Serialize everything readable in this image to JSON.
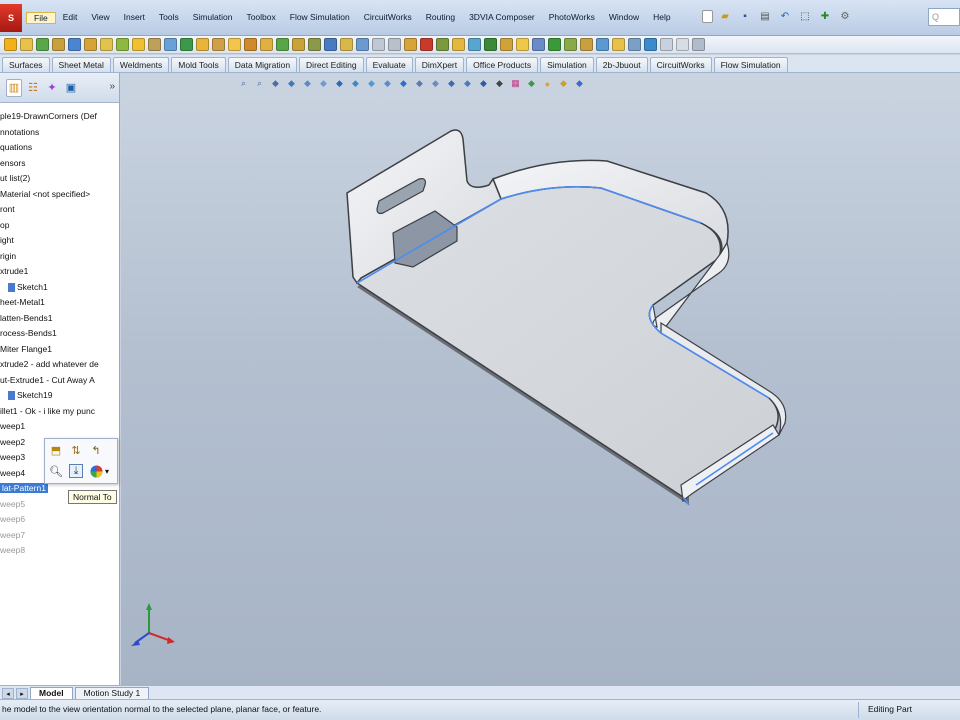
{
  "menubar": {
    "logo_text": "S",
    "items": [
      "File",
      "Edit",
      "View",
      "Insert",
      "Tools",
      "Simulation",
      "Toolbox",
      "Flow Simulation",
      "CircuitWorks",
      "Routing",
      "3DVIA Composer",
      "PhotoWorks",
      "Window",
      "Help"
    ],
    "search_text": "Q"
  },
  "command_tabs": [
    "Surfaces",
    "Sheet Metal",
    "Weldments",
    "Mold Tools",
    "Data Migration",
    "Direct Editing",
    "Evaluate",
    "DimXpert",
    "Office Products",
    "Simulation",
    "2b-Jbuout",
    "CircuitWorks",
    "Flow Simulation"
  ],
  "feature_tree": {
    "items": [
      {
        "label": "ple19-DrawnCorners  (Def",
        "level": 0,
        "state": "normal",
        "icon": "part-icon"
      },
      {
        "label": "nnotations",
        "level": 0,
        "state": "normal",
        "icon": "annotations-icon"
      },
      {
        "label": "quations",
        "level": 0,
        "state": "normal",
        "icon": "equations-icon"
      },
      {
        "label": "ensors",
        "level": 0,
        "state": "normal",
        "icon": "sensors-icon"
      },
      {
        "label": "ut list(2)",
        "level": 0,
        "state": "normal",
        "icon": "cutlist-icon"
      },
      {
        "label": "Material <not specified>",
        "level": 0,
        "state": "normal",
        "icon": "material-icon"
      },
      {
        "label": "ront",
        "level": 0,
        "state": "normal",
        "icon": "plane-icon"
      },
      {
        "label": "op",
        "level": 0,
        "state": "normal",
        "icon": "plane-icon"
      },
      {
        "label": "ight",
        "level": 0,
        "state": "normal",
        "icon": "plane-icon"
      },
      {
        "label": "rigin",
        "level": 0,
        "state": "normal",
        "icon": "origin-icon"
      },
      {
        "label": "xtrude1",
        "level": 0,
        "state": "normal",
        "icon": "extrude-icon"
      },
      {
        "label": "Sketch1",
        "level": 1,
        "state": "normal",
        "icon": "sketch-icon"
      },
      {
        "label": "heet-Metal1",
        "level": 0,
        "state": "normal",
        "icon": "sheetmetal-icon"
      },
      {
        "label": "latten-Bends1",
        "level": 0,
        "state": "normal",
        "icon": "flatten-icon"
      },
      {
        "label": "rocess-Bends1",
        "level": 0,
        "state": "normal",
        "icon": "bends-icon"
      },
      {
        "label": "Miter Flange1",
        "level": 0,
        "state": "normal",
        "icon": "flange-icon"
      },
      {
        "label": "xtrude2 - add whatever de",
        "level": 0,
        "state": "normal",
        "icon": "extrude-icon"
      },
      {
        "label": "ut-Extrude1 - Cut Away A",
        "level": 0,
        "state": "normal",
        "icon": "cut-icon"
      },
      {
        "label": "Sketch19",
        "level": 1,
        "state": "normal",
        "icon": "sketch-icon"
      },
      {
        "label": "illet1 - Ok - i like my punc",
        "level": 0,
        "state": "normal",
        "icon": "fillet-icon"
      },
      {
        "label": "weep1",
        "level": 0,
        "state": "normal",
        "icon": "sweep-icon"
      },
      {
        "label": "weep2",
        "level": 0,
        "state": "normal",
        "icon": "sweep-icon"
      },
      {
        "label": "weep3",
        "level": 0,
        "state": "normal",
        "icon": "sweep-icon"
      },
      {
        "label": "weep4",
        "level": 0,
        "state": "normal",
        "icon": "sweep-icon"
      },
      {
        "label": "lat-Pattern1",
        "level": 0,
        "state": "selected",
        "icon": "flatpattern-icon"
      },
      {
        "label": "weep5",
        "level": 0,
        "state": "suppressed",
        "icon": "sweep-icon"
      },
      {
        "label": "weep6",
        "level": 0,
        "state": "suppressed",
        "icon": "sweep-icon"
      },
      {
        "label": "weep7",
        "level": 0,
        "state": "suppressed",
        "icon": "sweep-icon"
      },
      {
        "label": "weep8",
        "level": 0,
        "state": "suppressed",
        "icon": "sweep-icon"
      }
    ]
  },
  "context_toolbar": {
    "icons": [
      "edit-feature-icon",
      "unsuppress-icon",
      "rollback-icon",
      "zoom-to-selection-icon",
      "normal-to-icon",
      "appearance-icon"
    ],
    "tooltip": "Normal To"
  },
  "bottom_tabs": [
    "Model",
    "Motion Study 1"
  ],
  "status": {
    "message": "he model to the view orientation normal to the selected plane, planar face, or feature.",
    "mode": "Editing Part"
  },
  "colors": {
    "selection": "#3a7bd5",
    "edge_highlight": "#4d8cf0",
    "part_face": "#d6d9dd",
    "part_edge": "#3c3f44"
  }
}
